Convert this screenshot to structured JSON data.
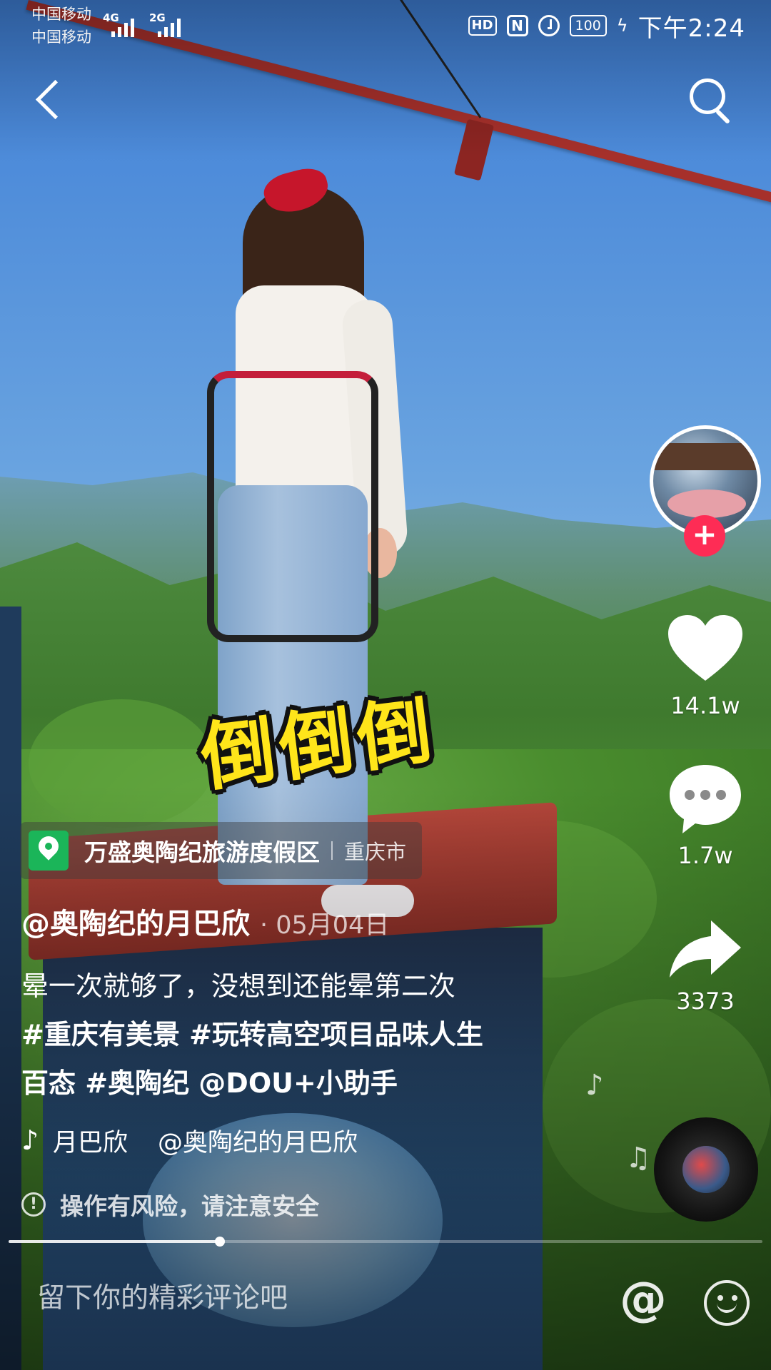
{
  "status_bar": {
    "carrier_1": "中国移动",
    "carrier_2": "中国移动",
    "network_1": "4G",
    "network_2": "2G",
    "hd": "HD",
    "nfc": "N",
    "battery": "100",
    "time": "下午2:24"
  },
  "video": {
    "sticker_text": "倒倒倒",
    "progress": 0.28
  },
  "sidebar": {
    "likes": "14.1w",
    "comments": "1.7w",
    "shares": "3373",
    "follow_symbol": "+"
  },
  "location": {
    "name": "万盛奥陶纪旅游度假区",
    "city": "重庆市"
  },
  "post": {
    "author": "@奥陶纪的月巴欣",
    "date": "· 05月04日",
    "caption_line1": "晕一次就够了，没想到还能晕第二次",
    "caption_line2": "#重庆有美景 #玩转高空项目品味人生",
    "caption_line3": "百态 #奥陶纪 @DOU+小助手"
  },
  "music": {
    "title": "月巴欣",
    "author": "@奥陶纪的月巴欣"
  },
  "warning": {
    "text": "操作有风险，请注意安全"
  },
  "comment_bar": {
    "placeholder": "留下你的精彩评论吧",
    "at_symbol": "@"
  },
  "icons": {
    "back": "back-chevron-icon",
    "search": "search-icon",
    "like": "heart-icon",
    "comment": "comment-bubble-icon",
    "share": "share-arrow-icon",
    "location": "location-pin-icon",
    "music": "tiktok-note-icon",
    "warning": "warning-circle-icon",
    "emoji": "emoji-icon"
  }
}
